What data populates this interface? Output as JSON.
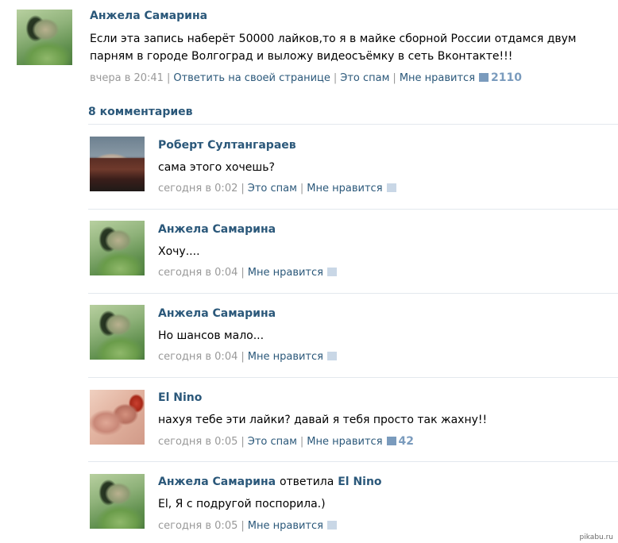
{
  "post": {
    "author": "Анжела Самарина",
    "text": "Если эта запись наберёт 50000 лайков,то я в майке сборной России отдамся двум парням в городе Волгоград и выложу видеосъёмку в сеть Вконтакте!!!",
    "time": "вчера в 20:41",
    "reply_label": "Ответить на своей странице",
    "spam_label": "Это спам",
    "like_label": "Мне нравится",
    "like_count": "2110"
  },
  "comments_header": "8 комментариев",
  "comments": [
    {
      "author": "Роберт Султангараев",
      "text": "сама этого хочешь?",
      "time": "сегодня в 0:02",
      "spam_label": "Это спам",
      "like_label": "Мне нравится",
      "like_count": ""
    },
    {
      "author": "Анжела Самарина",
      "text": "Хочу....",
      "time": "сегодня в 0:04",
      "like_label": "Мне нравится",
      "like_count": ""
    },
    {
      "author": "Анжела Самарина",
      "text": "Но шансов мало...",
      "time": "сегодня в 0:04",
      "like_label": "Мне нравится",
      "like_count": ""
    },
    {
      "author": "El Nino",
      "text": "нахуя тебе эти лайки? давай я тебя просто так жахну!!",
      "time": "сегодня в 0:05",
      "spam_label": "Это спам",
      "like_label": "Мне нравится",
      "like_count": "42"
    },
    {
      "author": "Анжела Самарина",
      "reply_word": "ответила",
      "reply_to": "El Nino",
      "text": "El, Я с подругой поспорила.)",
      "time": "сегодня в 0:05",
      "like_label": "Мне нравится",
      "like_count": ""
    }
  ],
  "watermark": "pikabu.ru",
  "colors": {
    "link": "#2b587a",
    "meta": "#999999",
    "heart": "#7a9bbd",
    "divider": "#e3e8ee"
  }
}
